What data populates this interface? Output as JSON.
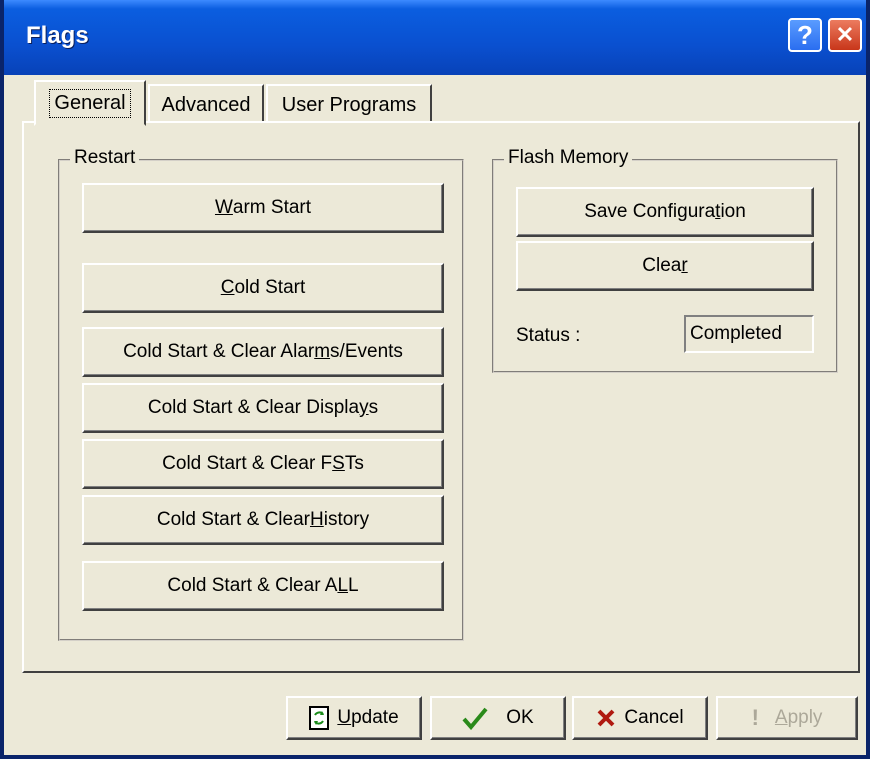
{
  "window": {
    "title": "Flags",
    "help_glyph": "?",
    "close_glyph": "✕"
  },
  "tabs": [
    {
      "label": "General",
      "active": true
    },
    {
      "label": "Advanced",
      "active": false
    },
    {
      "label": "User Programs",
      "active": false
    }
  ],
  "restart": {
    "group_label": "Restart",
    "buttons": [
      {
        "pre": "",
        "ul": "W",
        "post": "arm Start"
      },
      {
        "pre": "",
        "ul": "C",
        "post": "old Start"
      },
      {
        "pre": "Cold Start & Clear Alar",
        "ul": "m",
        "post": "s/Events"
      },
      {
        "pre": "Cold Start & Clear Displa",
        "ul": "y",
        "post": "s"
      },
      {
        "pre": "Cold Start & Clear F",
        "ul": "S",
        "post": "Ts"
      },
      {
        "pre": "Cold Start & Clear ",
        "ul": "H",
        "post": "istory"
      },
      {
        "pre": "Cold Start & Clear A",
        "ul": "L",
        "post": "L"
      }
    ]
  },
  "flash": {
    "group_label": "Flash Memory",
    "save": {
      "pre": "Save Configura",
      "ul": "t",
      "post": "ion"
    },
    "clear": {
      "pre": "Clea",
      "ul": "r",
      "post": ""
    },
    "status_label": "Status :",
    "status_value": "Completed"
  },
  "footer": {
    "update": {
      "ul": "U",
      "post": "pdate",
      "icon": "refresh-document-icon"
    },
    "ok": {
      "label": "OK",
      "icon": "checkmark-icon"
    },
    "cancel": {
      "label": "Cancel",
      "icon": "x-icon"
    },
    "apply": {
      "ul": "A",
      "post": "pply",
      "icon": "exclamation-icon",
      "disabled": true
    }
  },
  "colors": {
    "title_blue": "#0a50d0",
    "ok_green": "#2a8a1a",
    "cancel_red": "#b01a10",
    "face": "#ece9d8"
  }
}
